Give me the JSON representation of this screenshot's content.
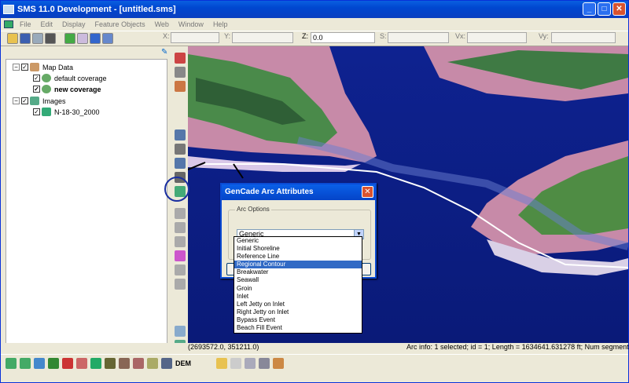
{
  "window": {
    "title": "SMS 11.0 Development - [untitled.sms]",
    "controls": [
      "minimize-icon",
      "maximize-icon",
      "close-icon"
    ]
  },
  "menu": [
    "File",
    "Edit",
    "Display",
    "Feature Objects",
    "Web",
    "Window",
    "Help"
  ],
  "coords": {
    "x_label": "X:",
    "y_label": "Y:",
    "z_label": "Z:",
    "z_value": "0.0",
    "s_label": "S:",
    "vx_label": "Vx:",
    "vy_label": "Vy:"
  },
  "tree": {
    "map_data": "Map Data",
    "default_coverage": "default coverage",
    "new_coverage": "new coverage",
    "images": "Images",
    "image_item": "N-18-30_2000"
  },
  "dialog": {
    "title": "GenCade Arc Attributes",
    "group_label": "Arc Options",
    "selected": "Generic",
    "options": [
      "Generic",
      "Initial Shoreline",
      "Reference Line",
      "Regional Contour",
      "Breakwater",
      "Seawall",
      "Groin",
      "Inlet",
      "Left Jetty on Inlet",
      "Right Jetty on Inlet",
      "Bypass Event",
      "Beach Fill Event"
    ],
    "highlighted_index": 3
  },
  "status": {
    "cursor": "(2693572.0, 351211.0)",
    "arc_info": "Arc info: 1 selected; id = 1; Length = 1634641.631278 ft; Num segments ="
  },
  "bottom_toolbar": {
    "dem_label": "DEM"
  },
  "colors": {
    "title_blue": "#0a4ad4",
    "selection": "#316ac5",
    "ocean": "#0c1e86"
  }
}
